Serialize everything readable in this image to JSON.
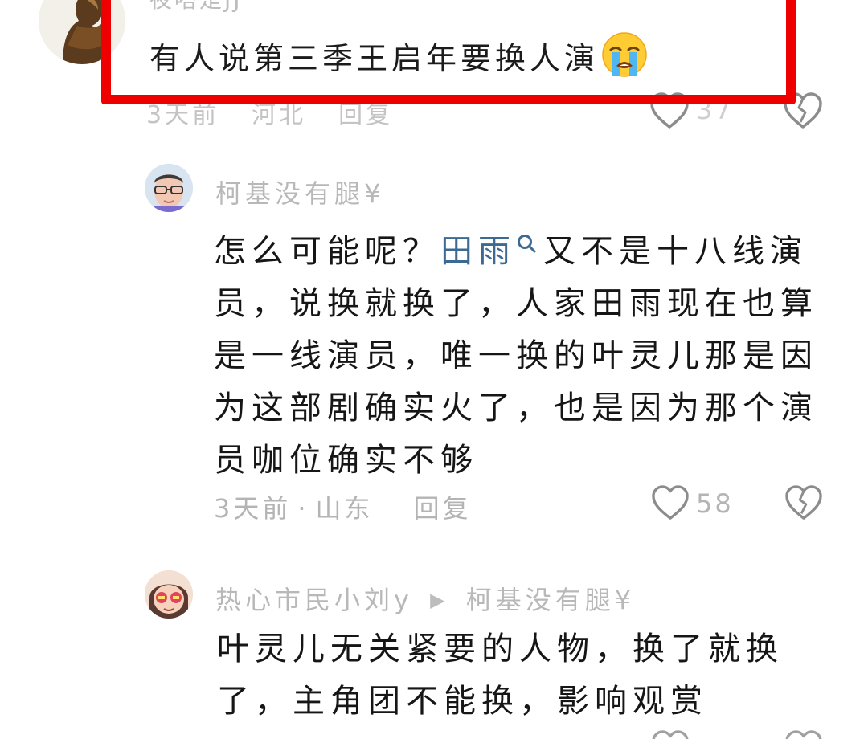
{
  "top_comment": {
    "username": "夜嗒是JJ",
    "text": "有人说第三季王启年要换人演",
    "emoji": "loudly-crying-face",
    "meta": {
      "time": "3天前",
      "location": "河北",
      "reply_label": "回复"
    },
    "like_count": "37"
  },
  "reply_1": {
    "username": "柯基没有腿¥",
    "text_before_link": "怎么可能呢？",
    "link_text": "田雨",
    "text_after_link": "又不是十八线演员，说换就换了，人家田雨现在也算是一线演员，唯一换的叶灵儿那是因为这部剧确实火了，也是因为那个演员咖位确实不够",
    "meta": {
      "time": "3天前",
      "separator": "·",
      "location": "山东",
      "reply_label": "回复"
    },
    "like_count": "58"
  },
  "reply_2": {
    "username": "热心市民小刘y",
    "reply_arrow": "▶",
    "reply_to": "柯基没有腿¥",
    "text": "叶灵儿无关紧要的人物，换了就换了，主角团不能换，影响观赏"
  },
  "colors": {
    "highlight_border": "#ef0000",
    "link": "#3d6a92",
    "muted_text": "#b4b4b4",
    "body_text": "#161616"
  }
}
